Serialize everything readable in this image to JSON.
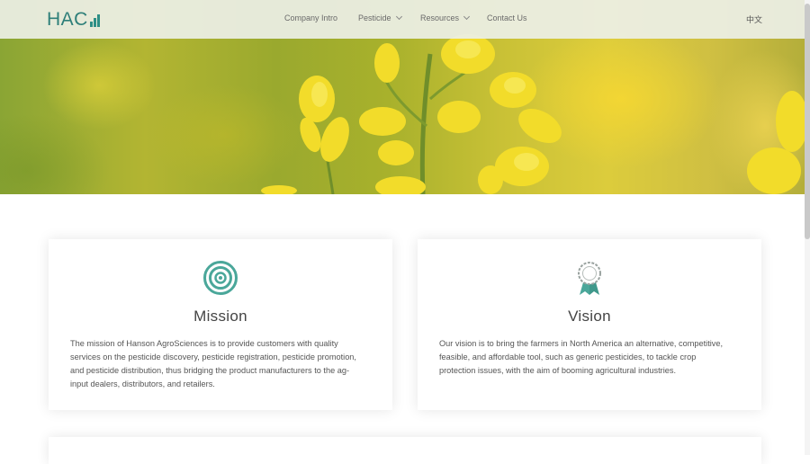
{
  "header": {
    "logo_text": "HAC",
    "nav": [
      {
        "label": "Company Intro",
        "has_dropdown": false
      },
      {
        "label": "Pesticide",
        "has_dropdown": true
      },
      {
        "label": "Resources",
        "has_dropdown": true
      },
      {
        "label": "Contact Us",
        "has_dropdown": false
      }
    ],
    "language": "中文"
  },
  "colors": {
    "brand": "#2e7f79",
    "accent": "#4aa79a"
  },
  "cards": [
    {
      "icon": "target-icon",
      "title": "Mission",
      "text": "The mission of Hanson AgroSciences is to provide customers with quality services on the pesticide discovery, pesticide registration, pesticide promotion, and pesticide distribution, thus bridging the product manufacturers to the ag-input dealers, distributors, and retailers."
    },
    {
      "icon": "award-badge-icon",
      "title": "Vision",
      "text": "Our vision is to bring the farmers in North America an alternative, competitive, feasible, and affordable tool, such as generic pesticides, to tackle crop protection issues, with the aim of booming agricultural industries."
    }
  ]
}
